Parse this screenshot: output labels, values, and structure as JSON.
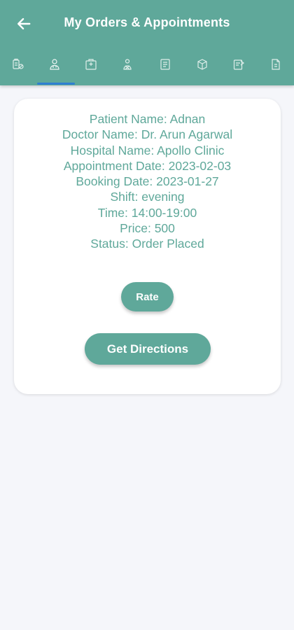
{
  "header": {
    "title": "My Orders & Appointments",
    "back_icon": "arrow-left-icon"
  },
  "tabs": [
    {
      "icon": "medicine-icon",
      "selected": false
    },
    {
      "icon": "doctor-icon",
      "selected": true
    },
    {
      "icon": "hospital-icon",
      "selected": false
    },
    {
      "icon": "lab-test-icon",
      "selected": false
    },
    {
      "icon": "document-icon",
      "selected": false
    },
    {
      "icon": "package-icon",
      "selected": false
    },
    {
      "icon": "prescription-icon",
      "selected": false
    },
    {
      "icon": "report-icon",
      "selected": false
    }
  ],
  "order": {
    "patient_name": "Patient Name: Adnan",
    "doctor_name": "Doctor Name: Dr. Arun Agarwal",
    "hospital_name": "Hospital Name: Apollo Clinic",
    "appointment_date": "Appointment Date: 2023-02-03",
    "booking_date": "Booking Date: 2023-01-27",
    "shift": "Shift: evening",
    "time": "Time: 14:00-19:00",
    "price": "Price: 500",
    "status": "Status: Order Placed"
  },
  "actions": {
    "rate_label": "Rate",
    "directions_label": "Get Directions"
  },
  "colors": {
    "primary": "#5fa89a",
    "tab_indicator": "#2f7fd1",
    "background": "#f5f6fa"
  }
}
